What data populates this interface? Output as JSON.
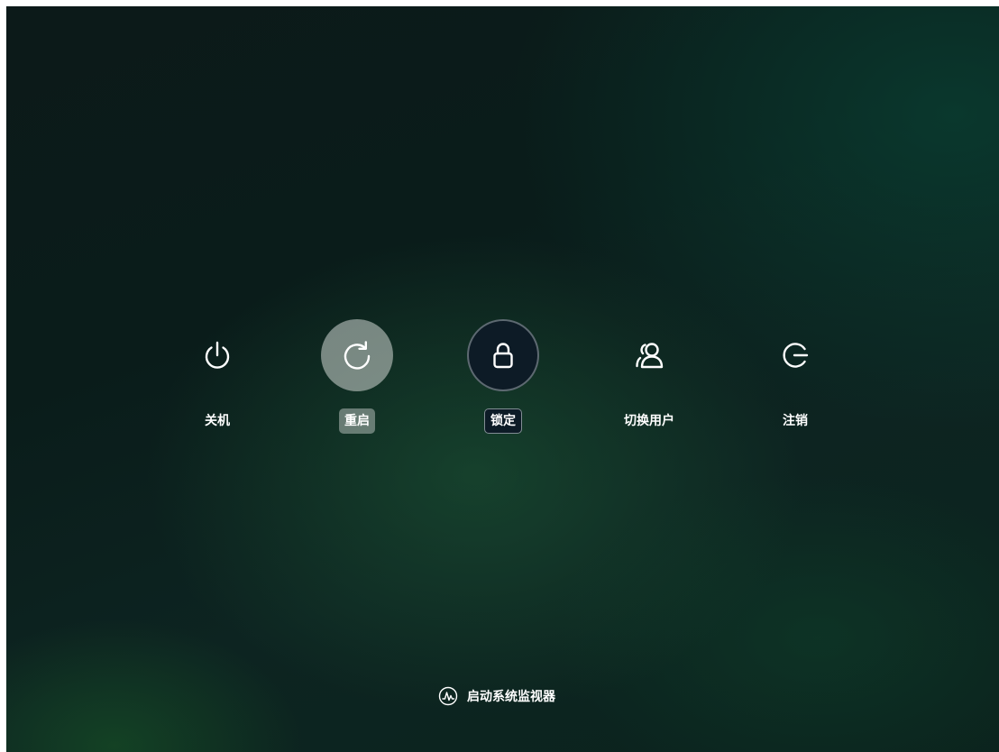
{
  "actions": {
    "shutdown": {
      "label": "关机",
      "icon": "power-icon"
    },
    "reboot": {
      "label": "重启",
      "icon": "reboot-icon"
    },
    "lock": {
      "label": "锁定",
      "icon": "lock-icon"
    },
    "switch_user": {
      "label": "切换用户",
      "icon": "users-icon"
    },
    "logout": {
      "label": "注销",
      "icon": "logout-icon"
    }
  },
  "system_monitor": {
    "label": "启动系统监视器",
    "icon": "system-monitor-icon"
  },
  "colors": {
    "background": "#0b1d1b",
    "hover": "#c8cdca",
    "focused": "#0d1b26",
    "text": "#ffffff"
  }
}
